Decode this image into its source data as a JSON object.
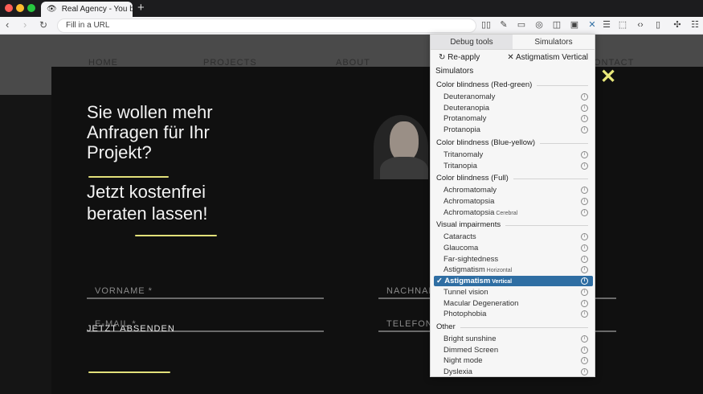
{
  "browser": {
    "tab_title": "Real Agency - You b",
    "url_placeholder": "Fill in a URL",
    "new_tab": "+"
  },
  "page": {
    "nav": [
      "HOME",
      "PROJECTS",
      "ABOUT",
      "CONTACT"
    ],
    "headline": "Sie wollen mehr Anfragen für Ihr Projekt?",
    "headline2": "Jetzt kostenfrei beraten lassen!",
    "fields": {
      "vorname": "VORNAME *",
      "nachname": "NACHNAME *",
      "email": "E-MAIL *",
      "telefon": "TELEFON *"
    },
    "submit": "JETZT ABSENDEN",
    "close": "✕",
    "accent_color": "#e2e07a"
  },
  "panel": {
    "tabs": [
      "Debug tools",
      "Simulators"
    ],
    "reapply": "Re-apply",
    "current": "Astigmatism Vertical",
    "simulators_title": "Simulators",
    "groups": [
      {
        "title": "Color blindness (Red-green)",
        "items": [
          {
            "label": "Deuteranomaly",
            "sub": ""
          },
          {
            "label": "Deuteranopia",
            "sub": ""
          },
          {
            "label": "Protanomaly",
            "sub": ""
          },
          {
            "label": "Protanopia",
            "sub": ""
          }
        ]
      },
      {
        "title": "Color blindness (Blue-yellow)",
        "items": [
          {
            "label": "Tritanomaly",
            "sub": ""
          },
          {
            "label": "Tritanopia",
            "sub": ""
          }
        ]
      },
      {
        "title": "Color blindness (Full)",
        "items": [
          {
            "label": "Achromatomaly",
            "sub": ""
          },
          {
            "label": "Achromatopsia",
            "sub": ""
          },
          {
            "label": "Achromatopsia",
            "sub": "Cerebral"
          }
        ]
      },
      {
        "title": "Visual impairments",
        "items": [
          {
            "label": "Cataracts",
            "sub": ""
          },
          {
            "label": "Glaucoma",
            "sub": ""
          },
          {
            "label": "Far-sightedness",
            "sub": ""
          },
          {
            "label": "Astigmatism",
            "sub": "Horizontal"
          },
          {
            "label": "Astigmatism",
            "sub": "Vertical",
            "selected": true
          },
          {
            "label": "Tunnel vision",
            "sub": ""
          },
          {
            "label": "Macular Degeneration",
            "sub": ""
          },
          {
            "label": "Photophobia",
            "sub": ""
          }
        ]
      },
      {
        "title": "Other",
        "items": [
          {
            "label": "Bright sunshine",
            "sub": ""
          },
          {
            "label": "Dimmed Screen",
            "sub": ""
          },
          {
            "label": "Night mode",
            "sub": ""
          },
          {
            "label": "Dyslexia",
            "sub": ""
          }
        ]
      }
    ],
    "selected_color": "#2f6ea3"
  }
}
